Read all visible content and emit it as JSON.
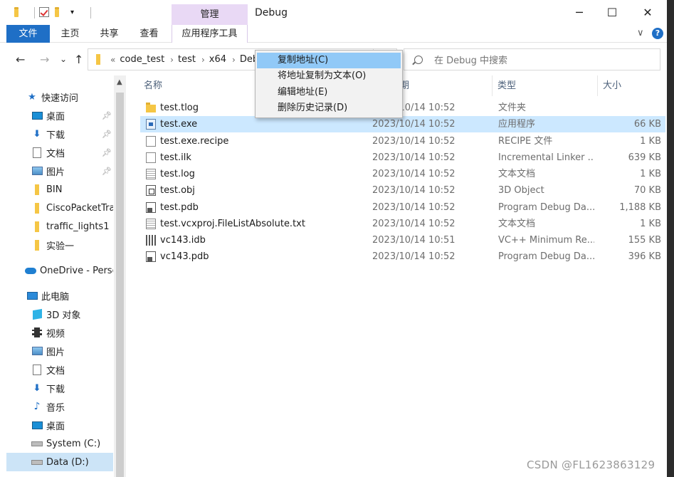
{
  "window": {
    "title": "Debug",
    "manage_tab": "管理",
    "minimize": "─",
    "maximize": "☐",
    "close": "✕"
  },
  "ribbon": {
    "tabs": [
      {
        "label": "文件"
      },
      {
        "label": "主页"
      },
      {
        "label": "共享"
      },
      {
        "label": "查看"
      },
      {
        "label": "应用程序工具"
      }
    ],
    "expand_chevron": "∨",
    "help": "?"
  },
  "nav": {
    "back": "←",
    "forward": "→",
    "recent": "⌄",
    "up": "↑"
  },
  "address": {
    "overflow": "«",
    "crumbs": [
      "code_test",
      "test",
      "x64",
      "Debug"
    ]
  },
  "search": {
    "placeholder": "在 Debug 中搜索"
  },
  "sidebar": {
    "items": [
      {
        "label": "快速访问",
        "icon": "star-icon"
      },
      {
        "label": "桌面",
        "icon": "desktop-icon",
        "pinned": true
      },
      {
        "label": "下载",
        "icon": "download-icon",
        "pinned": true
      },
      {
        "label": "文档",
        "icon": "document-icon",
        "pinned": true
      },
      {
        "label": "图片",
        "icon": "pictures-icon",
        "pinned": true
      },
      {
        "label": "BIN",
        "icon": "folder-icon"
      },
      {
        "label": "CiscoPacketTra",
        "icon": "folder-icon"
      },
      {
        "label": "traffic_lights1",
        "icon": "folder-icon"
      },
      {
        "label": "实验一",
        "icon": "folder-icon"
      },
      {
        "label": "OneDrive - Persc",
        "icon": "onedrive-icon"
      },
      {
        "label": "此电脑",
        "icon": "this-pc-icon"
      },
      {
        "label": "3D 对象",
        "icon": "3d-objects-icon"
      },
      {
        "label": "视频",
        "icon": "video-icon"
      },
      {
        "label": "图片",
        "icon": "pictures-icon"
      },
      {
        "label": "文档",
        "icon": "document-icon"
      },
      {
        "label": "下载",
        "icon": "download-icon"
      },
      {
        "label": "音乐",
        "icon": "music-icon"
      },
      {
        "label": "桌面",
        "icon": "desktop-icon"
      },
      {
        "label": "System (C:)",
        "icon": "drive-icon"
      },
      {
        "label": "Data (D:)",
        "icon": "drive-icon",
        "selected": true
      }
    ],
    "scroll_up": "▲"
  },
  "columns": {
    "name": "名称",
    "date": "修改日期",
    "type": "类型",
    "size": "大小"
  },
  "files": [
    {
      "name": "test.tlog",
      "date": "2023/10/14 10:52",
      "type": "文件夹",
      "size": "",
      "icon": "folder-icon"
    },
    {
      "name": "test.exe",
      "date": "2023/10/14 10:52",
      "type": "应用程序",
      "size": "66 KB",
      "icon": "exe-icon",
      "selected": true
    },
    {
      "name": "test.exe.recipe",
      "date": "2023/10/14 10:52",
      "type": "RECIPE 文件",
      "size": "1 KB",
      "icon": "blank-file-icon"
    },
    {
      "name": "test.ilk",
      "date": "2023/10/14 10:52",
      "type": "Incremental Linker ...",
      "size": "639 KB",
      "icon": "ilk-file-icon"
    },
    {
      "name": "test.log",
      "date": "2023/10/14 10:52",
      "type": "文本文档",
      "size": "1 KB",
      "icon": "text-file-icon"
    },
    {
      "name": "test.obj",
      "date": "2023/10/14 10:52",
      "type": "3D Object",
      "size": "70 KB",
      "icon": "obj-file-icon"
    },
    {
      "name": "test.pdb",
      "date": "2023/10/14 10:52",
      "type": "Program Debug Da...",
      "size": "1,188 KB",
      "icon": "pdb-file-icon"
    },
    {
      "name": "test.vcxproj.FileListAbsolute.txt",
      "date": "2023/10/14 10:52",
      "type": "文本文档",
      "size": "1 KB",
      "icon": "text-file-icon"
    },
    {
      "name": "vc143.idb",
      "date": "2023/10/14 10:51",
      "type": "VC++ Minimum Re...",
      "size": "155 KB",
      "icon": "idb-file-icon"
    },
    {
      "name": "vc143.pdb",
      "date": "2023/10/14 10:52",
      "type": "Program Debug Da...",
      "size": "396 KB",
      "icon": "pdb-file-icon"
    }
  ],
  "context_menu": {
    "items": [
      {
        "label": "复制地址(C)",
        "highlighted": true
      },
      {
        "label": "将地址复制为文本(O)"
      },
      {
        "label": "编辑地址(E)"
      },
      {
        "label": "删除历史记录(D)"
      }
    ]
  },
  "watermark": "CSDN @FL1623863129",
  "colors": {
    "accent": "#1f6fc6",
    "manage_tab_bg": "#e9d9f5",
    "selected_row": "#cce8ff",
    "menu_highlight": "#91c9f7"
  }
}
